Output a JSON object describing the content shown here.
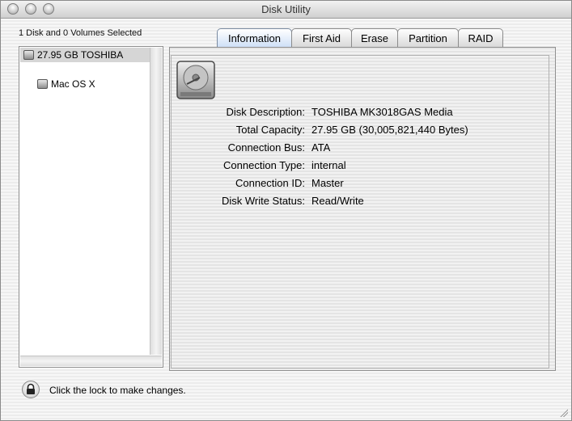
{
  "window": {
    "title": "Disk Utility"
  },
  "sidebar": {
    "selection_label": "1 Disk and 0 Volumes Selected",
    "items": [
      {
        "label": "27.95 GB TOSHIBA",
        "selected": true,
        "icon": "disk-icon"
      },
      {
        "label": "Mac OS X",
        "selected": false,
        "icon": "volume-icon"
      }
    ]
  },
  "tabs": [
    {
      "label": "Information",
      "active": true
    },
    {
      "label": "First Aid",
      "active": false
    },
    {
      "label": "Erase",
      "active": false
    },
    {
      "label": "Partition",
      "active": false
    },
    {
      "label": "RAID",
      "active": false
    }
  ],
  "info": {
    "rows": [
      {
        "label": "Disk Description:",
        "value": "TOSHIBA MK3018GAS Media"
      },
      {
        "label": "Total Capacity:",
        "value": "27.95 GB (30,005,821,440 Bytes)"
      },
      {
        "label": "Connection Bus:",
        "value": "ATA"
      },
      {
        "label": "Connection Type:",
        "value": "internal"
      },
      {
        "label": "Connection ID:",
        "value": "Master"
      },
      {
        "label": "Disk Write Status:",
        "value": "Read/Write"
      }
    ]
  },
  "footer": {
    "lock_label": "Click the lock to make changes.",
    "lock_icon": "lock-icon"
  },
  "colors": {
    "tab_active": "#cfe0f7",
    "selection": "#d6d6d6"
  }
}
